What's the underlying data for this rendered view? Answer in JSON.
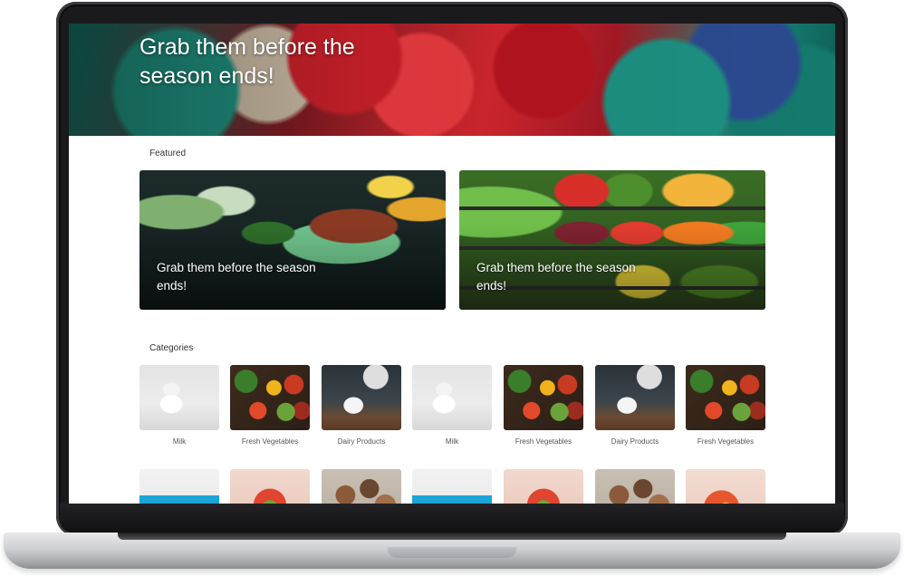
{
  "hero": {
    "title": "Grab them before the season ends!"
  },
  "featured": {
    "label": "Featured",
    "cards": [
      {
        "text": "Grab them before the season ends!"
      },
      {
        "text": "Grab them before the season ends!"
      }
    ]
  },
  "categories": {
    "label": "Categories",
    "items": [
      {
        "label": "Milk"
      },
      {
        "label": "Fresh Vegetables"
      },
      {
        "label": "Dairy Products"
      },
      {
        "label": "Milk"
      },
      {
        "label": "Fresh Vegetables"
      },
      {
        "label": "Dairy Products"
      },
      {
        "label": "Fresh Vegetables"
      }
    ]
  }
}
